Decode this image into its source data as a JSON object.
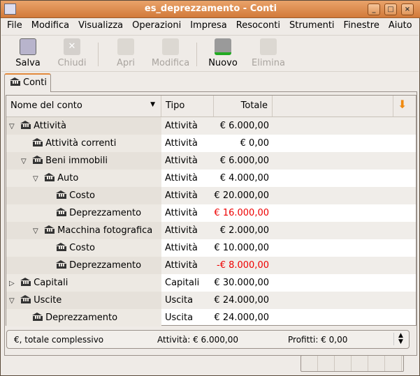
{
  "window": {
    "title": "es_deprezzamento - Conti",
    "buttons": [
      "_",
      "□",
      "×"
    ]
  },
  "menu": [
    "File",
    "Modifica",
    "Visualizza",
    "Operazioni",
    "Impresa",
    "Resoconti",
    "Strumenti",
    "Finestre",
    "Aiuto"
  ],
  "toolbar": {
    "save": "Salva",
    "close": "Chiudi",
    "open": "Apri",
    "edit": "Modifica",
    "new": "Nuovo",
    "delete": "Elimina"
  },
  "tab": {
    "label": "Conti"
  },
  "columns": {
    "name": "Nome del conto",
    "type": "Tipo",
    "total": "Totale"
  },
  "rows": [
    {
      "name": "Attività",
      "type": "Attività",
      "total": "€ 6.000,00",
      "depth": 0,
      "expander": "open"
    },
    {
      "name": "Attività correnti",
      "type": "Attività",
      "total": "€ 0,00",
      "depth": 1,
      "expander": "none"
    },
    {
      "name": "Beni immobili",
      "type": "Attività",
      "total": "€ 6.000,00",
      "depth": 1,
      "expander": "open"
    },
    {
      "name": "Auto",
      "type": "Attività",
      "total": "€ 4.000,00",
      "depth": 2,
      "expander": "open"
    },
    {
      "name": "Costo",
      "type": "Attività",
      "total": "€ 20.000,00",
      "depth": 3,
      "expander": "none"
    },
    {
      "name": "Deprezzamento",
      "type": "Attività",
      "total": "€ 16.000,00",
      "depth": 3,
      "expander": "none",
      "negative": true
    },
    {
      "name": "Macchina fotografica",
      "type": "Attività",
      "total": "€ 2.000,00",
      "depth": 2,
      "expander": "open"
    },
    {
      "name": "Costo",
      "type": "Attività",
      "total": "€ 10.000,00",
      "depth": 3,
      "expander": "none"
    },
    {
      "name": "Deprezzamento",
      "type": "Attività",
      "total": "-€ 8.000,00",
      "depth": 3,
      "expander": "none",
      "negative": true
    },
    {
      "name": "Capitali",
      "type": "Capitali",
      "total": "€ 30.000,00",
      "depth": 0,
      "expander": "closed"
    },
    {
      "name": "Uscite",
      "type": "Uscita",
      "total": "€ 24.000,00",
      "depth": 0,
      "expander": "open"
    },
    {
      "name": "Deprezzamento",
      "type": "Uscita",
      "total": "€ 24.000,00",
      "depth": 1,
      "expander": "none"
    }
  ],
  "summary": {
    "currency": "€, totale complessivo",
    "assets": "Attività: € 6.000,00",
    "profits": "Profitti: € 0,00"
  },
  "colors": {
    "negative": "#e00000",
    "accent": "#e38a3c"
  }
}
